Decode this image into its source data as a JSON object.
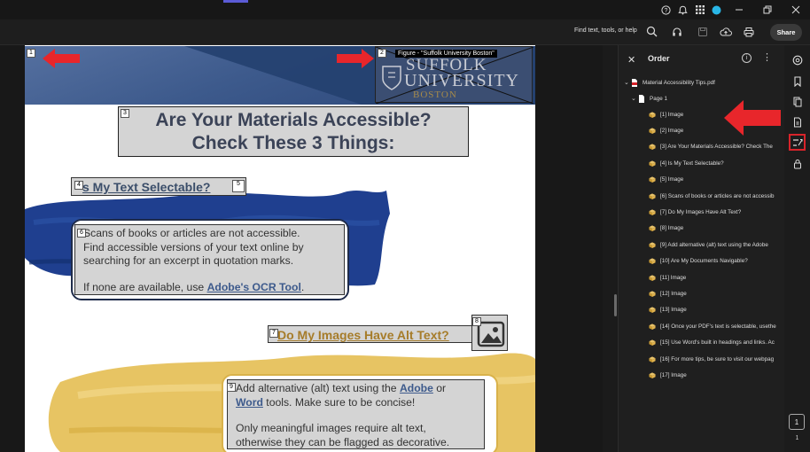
{
  "window": {
    "icons": [
      "help-icon",
      "bell-icon",
      "apps-grid-icon",
      "profile-icon"
    ],
    "controls": [
      "minimize-icon",
      "restore-icon",
      "close-icon"
    ]
  },
  "toolbar": {
    "find_placeholder": "Find text, tools, or help",
    "share_label": "Share"
  },
  "document": {
    "figure_label": "Figure - \"Suffolk University Boston\"",
    "logo_line1": "SUFFOLK",
    "logo_line2": "UNIVERSITY",
    "logo_line3": "BOSTON",
    "heading_line1": "Are Your Materials Accessible?",
    "heading_line2": "Check These 3 Things:",
    "q1": "s My Text Selectable?",
    "card1": {
      "line1": "Scans of books or articles are not accessible.",
      "line2": "Find accessible versions of your text online by",
      "line3": "searching for an excerpt in quotation marks.",
      "line4_pre": "If none are available, use ",
      "line4_link": "Adobe's OCR Tool",
      "line4_post": "."
    },
    "q2": "Do My Images Have Alt Text?",
    "card2": {
      "line1_pre": "Add alternative (alt) text using the ",
      "line1_link": "Adobe",
      "line1_post": " or",
      "line2_link": "Word",
      "line2_post": " tools. Make sure to be concise!",
      "line3": "Only meaningful images require alt text,",
      "line4": "otherwise they can be flagged as decorative."
    },
    "tags": [
      "1",
      "2",
      "3",
      "4",
      "5",
      "6",
      "7",
      "8",
      "9"
    ]
  },
  "order_panel": {
    "title": "Order",
    "file": "Material Accessibility Tips.pdf",
    "page": "Page 1",
    "items": [
      "[1] Image",
      "[2] Image",
      "[3] Are Your Materials Accessible? Check The",
      "[4] Is My Text Selectable?",
      "[5] Image",
      "[6] Scans of books or articles are not accessib",
      "[7] Do My Images Have Alt Text?",
      "[8] Image",
      "[9] Add alternative (alt) text using the Adobe",
      "[10] Are My Documents Navigable?",
      "[11] Image",
      "[12] Image",
      "[13] Image",
      "[14] Once your PDF's text is selectable, usethe",
      "[15] Use Word's built in headings and links. Ac",
      "[16] For more tips, be sure to visit our webpag",
      "[17] Image"
    ]
  },
  "rail": {
    "icons": [
      "comment-icon",
      "bookmark-icon",
      "pages-icon",
      "attachment-icon",
      "reading-order-icon",
      "protect-icon"
    ],
    "current_page": "1",
    "total_pages": "1"
  },
  "colors": {
    "annotation_red": "#e8262b",
    "banner_blue": "#2e4a7a",
    "heading_text": "#3b4357",
    "link_blue": "#3d5a8c",
    "gold": "#a67c2a"
  }
}
